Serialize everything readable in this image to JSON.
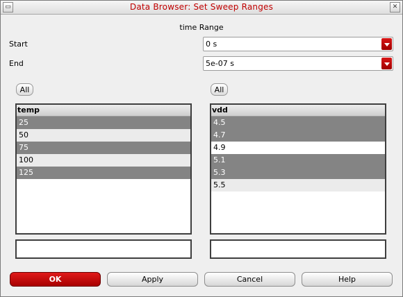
{
  "window": {
    "title": "Data Browser: Set Sweep Ranges",
    "menu_glyph": "▭",
    "close_glyph": "✕"
  },
  "range": {
    "title": "time Range",
    "start_label": "Start",
    "start_value": "0 s",
    "end_label": "End",
    "end_value": "5e-07 s"
  },
  "left_list": {
    "all_label": "All",
    "header": "temp",
    "items": [
      {
        "label": "25",
        "state": "sel"
      },
      {
        "label": "50",
        "state": "alt"
      },
      {
        "label": "75",
        "state": "sel"
      },
      {
        "label": "100",
        "state": "alt"
      },
      {
        "label": "125",
        "state": "sel"
      }
    ],
    "filter_value": ""
  },
  "right_list": {
    "all_label": "All",
    "header": "vdd",
    "items": [
      {
        "label": "4.5",
        "state": "sel"
      },
      {
        "label": "4.7",
        "state": "sel"
      },
      {
        "label": "4.9",
        "state": "plain"
      },
      {
        "label": "5.1",
        "state": "sel"
      },
      {
        "label": "5.3",
        "state": "sel"
      },
      {
        "label": "5.5",
        "state": "alt"
      }
    ],
    "filter_value": ""
  },
  "buttons": {
    "ok": "OK",
    "apply": "Apply",
    "cancel": "Cancel",
    "help": "Help"
  },
  "colors": {
    "accent": "#c00000",
    "selected_row": "#848484"
  }
}
